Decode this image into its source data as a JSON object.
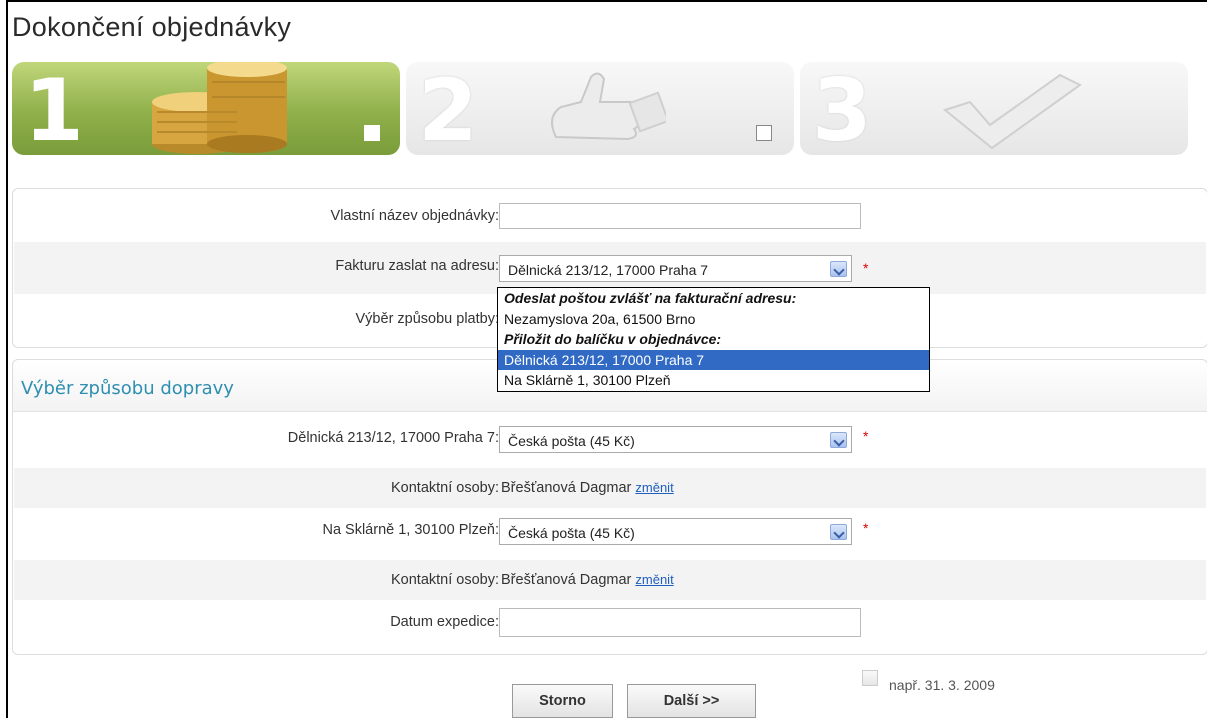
{
  "page": {
    "title": "Dokončení objednávky"
  },
  "steps": [
    {
      "number": "1",
      "icon": "coins-icon",
      "active": true
    },
    {
      "number": "2",
      "icon": "thumbs-up-icon",
      "active": false
    },
    {
      "number": "3",
      "icon": "checkmark-icon",
      "active": false
    }
  ],
  "order": {
    "name_label": "Vlastní název objednávky:",
    "name_value": "",
    "invoice_label": "Fakturu zaslat na adresu:",
    "invoice_selected": "Dělnická 213/12, 17000 Praha 7",
    "payment_label": "Výběr způsobu platby:",
    "dropdown_options": [
      {
        "label": "Odeslat poštou zvlášť na fakturační adresu:",
        "type": "group"
      },
      {
        "label": "Nezamyslova 20a, 61500 Brno",
        "type": "option"
      },
      {
        "label": "Přiložit do balíčku v objednávce:",
        "type": "group"
      },
      {
        "label": "Dělnická 213/12, 17000 Praha 7",
        "type": "option",
        "selected": true
      },
      {
        "label": "Na Sklárně 1, 30100 Plzeň",
        "type": "option"
      }
    ]
  },
  "shipping": {
    "section_title": "Výběr způsobu dopravy",
    "addr1_label": "Dělnická 213/12, 17000 Praha 7:",
    "addr1_value": "Česká pošta (45 Kč)",
    "contact_label": "Kontaktní osoby:",
    "contact1_name": "Břešťanová Dagmar",
    "change_link": "změnit",
    "addr2_label": "Na Sklárně 1, 30100 Plzeň:",
    "addr2_value": "Česká pošta (45 Kč)",
    "contact2_name": "Břešťanová Dagmar",
    "date_label": "Datum expedice:",
    "date_value": "",
    "date_hint": "např. 31. 3. 2009",
    "required_mark": "*"
  },
  "buttons": {
    "cancel": "Storno",
    "next": "Další >>"
  },
  "colors": {
    "active_step": "#8fb04a",
    "section_title": "#2f8fb0",
    "selected_option": "#316ac5",
    "required": "#dd0000"
  }
}
